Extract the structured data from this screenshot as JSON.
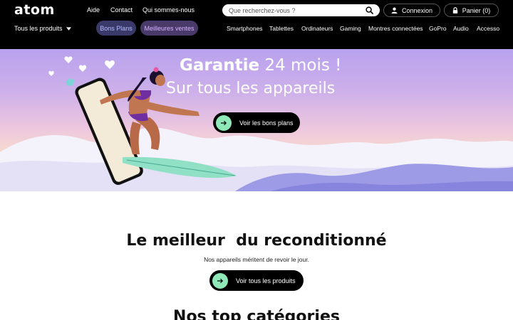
{
  "header": {
    "logo": "atom",
    "links": [
      "Aide",
      "Contact",
      "Qui sommes-nous"
    ],
    "search_placeholder": "Que recherchez-vous ?",
    "login_label": "Connexion",
    "cart_label": "Panier (0)"
  },
  "catnav": {
    "all_products": "Tous les produits",
    "tags": [
      "Bons Plans",
      "Meilleures ventes"
    ],
    "categories": [
      "Smartphones",
      "Tablettes",
      "Ordinateurs",
      "Gaming",
      "Montres connectées",
      "GoPro",
      "Audio",
      "Accesso"
    ]
  },
  "hero": {
    "title_bold": "Garantie",
    "title_rest": " 24 mois !",
    "subtitle": "Sur tous les appareils",
    "cta": "Voir les bons plans"
  },
  "best": {
    "title_pre": "Le ",
    "title_bold": "meilleur",
    "title_post": "  du reconditionné",
    "subtitle": "Nos appareils méritent de revoir le jour.",
    "cta": "Voir tous les produits"
  },
  "categories_section": {
    "title_pre": "Nos ",
    "title_bold": "top",
    "title_post": " catégories"
  },
  "colors": {
    "header_bg": "#000000",
    "cta_bg": "#000000",
    "cta_arrow": "#8ee8b8",
    "tag_bons_text": "#b7b9ff",
    "tag_meilleures_text": "#d5b3ff"
  },
  "icons": [
    "search-icon",
    "user-icon",
    "lock-icon",
    "chevron-down-icon",
    "arrow-right-icon"
  ]
}
